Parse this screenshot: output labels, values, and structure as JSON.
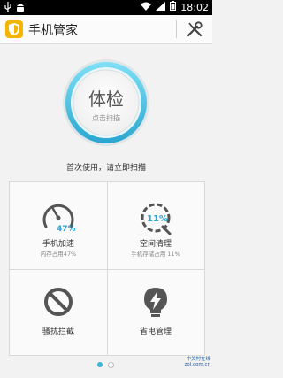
{
  "status_bar": {
    "time": "18:02",
    "left_icons": [
      "usb-icon",
      "android-icon"
    ],
    "right_icons": [
      "wifi-icon",
      "signal-icon",
      "battery-icon"
    ]
  },
  "app_bar": {
    "title": "手机管家",
    "logo_icon": "shield-logo-icon",
    "settings_icon": "tools-icon"
  },
  "scan": {
    "title": "体检",
    "subtitle": "点击扫描",
    "hint": "首次使用，请立即扫描",
    "accent_color": "#2fb0d6"
  },
  "features": [
    {
      "label": "手机加速",
      "sub": "内存占用47%",
      "percent_text": "47%",
      "value": 47,
      "icon": "speed-gauge-icon"
    },
    {
      "label": "空间清理",
      "sub": "手机存储占用 11%",
      "percent_text": "11%",
      "value": 11,
      "icon": "broom-clean-icon"
    },
    {
      "label": "骚扰拦截",
      "sub": "",
      "icon": "block-icon"
    },
    {
      "label": "省电管理",
      "sub": "",
      "icon": "battery-lightning-icon"
    }
  ],
  "pager": {
    "pages": 2,
    "current": 1
  },
  "watermark": {
    "line1": "中关村在线",
    "line2": "zol.com.cn"
  }
}
